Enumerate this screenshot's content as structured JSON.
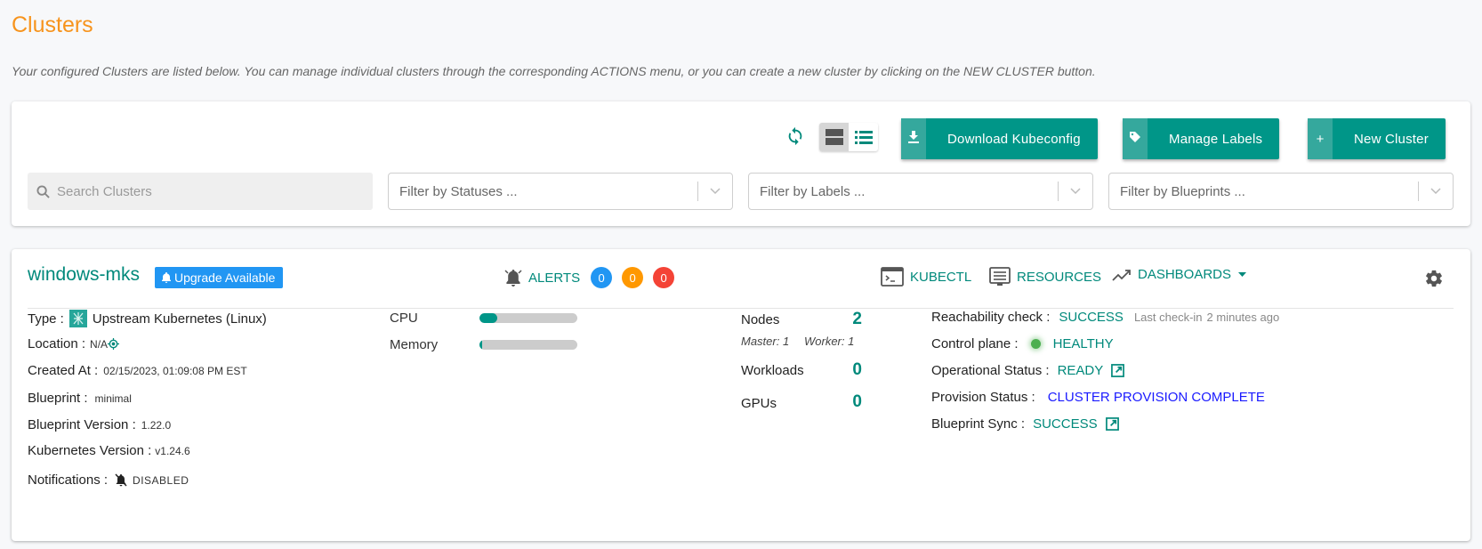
{
  "page": {
    "title": "Clusters",
    "description": "Your configured Clusters are listed below. You can manage individual clusters through the corresponding ACTIONS menu, or you can create a new cluster by clicking on the NEW CLUSTER button."
  },
  "toolbar": {
    "refresh_icon": "refresh-icon",
    "view_modes": [
      {
        "name": "card-view",
        "icon": "card-view-icon",
        "active": true
      },
      {
        "name": "list-view",
        "icon": "list-view-icon",
        "active": false
      }
    ],
    "download_kubeconfig_label": "Download Kubeconfig",
    "manage_labels_label": "Manage Labels",
    "new_cluster_label": "New Cluster",
    "search_placeholder": "Search Clusters",
    "filters": {
      "statuses_placeholder": "Filter by Statuses ...",
      "labels_placeholder": "Filter by Labels ...",
      "blueprints_placeholder": "Filter by Blueprints ..."
    }
  },
  "cluster": {
    "name": "windows-mks",
    "upgrade_badge": "Upgrade Available",
    "alerts": {
      "label": "ALERTS",
      "counts": [
        {
          "value": "0",
          "color": "#2196f3"
        },
        {
          "value": "0",
          "color": "#ff9800"
        },
        {
          "value": "0",
          "color": "#f44336"
        }
      ]
    },
    "actions": {
      "kubectl": "KUBECTL",
      "resources": "RESOURCES",
      "dashboards": "DASHBOARDS"
    },
    "details": {
      "type_label": "Type :",
      "type_value": "Upstream Kubernetes (Linux)",
      "location_label": "Location :",
      "location_value": "N/A",
      "created_label": "Created At :",
      "created_value": "02/15/2023, 01:09:08 PM EST",
      "blueprint_label": "Blueprint :",
      "blueprint_value": "minimal",
      "blueprint_version_label": "Blueprint Version :",
      "blueprint_version_value": "1.22.0",
      "k8s_version_label": "Kubernetes Version :",
      "k8s_version_value": "v1.24.6",
      "notifications_label": "Notifications :",
      "notifications_value": "DISABLED"
    },
    "usage": {
      "cpu_label": "CPU",
      "cpu_percent": 18,
      "memory_label": "Memory",
      "memory_percent": 3
    },
    "stats": {
      "nodes_label": "Nodes",
      "nodes_value": "2",
      "master_text": "Master: 1",
      "worker_text": "Worker: 1",
      "workloads_label": "Workloads",
      "workloads_value": "0",
      "gpus_label": "GPUs",
      "gpus_value": "0"
    },
    "status": {
      "reachability_label": "Reachability check :",
      "reachability_value": "SUCCESS",
      "last_checkin_label": "Last check-in",
      "last_checkin_value": "2 minutes ago",
      "control_plane_label": "Control plane :",
      "control_plane_value": "HEALTHY",
      "operational_label": "Operational Status :",
      "operational_value": "READY",
      "provision_label": "Provision Status :",
      "provision_value": "CLUSTER PROVISION COMPLETE",
      "blueprint_sync_label": "Blueprint Sync :",
      "blueprint_sync_value": "SUCCESS"
    }
  }
}
